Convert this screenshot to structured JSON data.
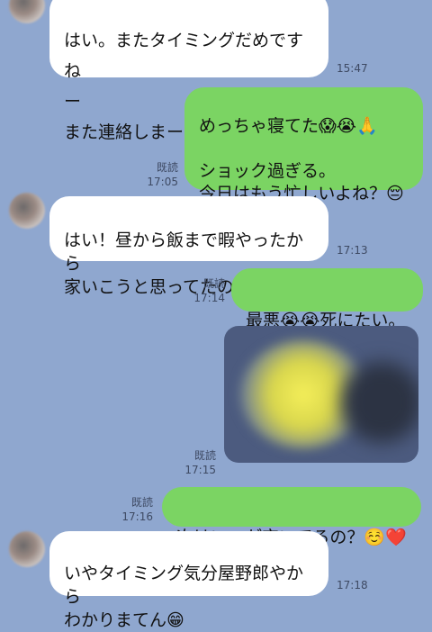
{
  "messages": [
    {
      "side": "in",
      "text": "はい。またタイミングだめですね\nー\nまた連絡しまーす！",
      "time": "15:47"
    },
    {
      "side": "out",
      "text": "めっちゃ寝てた😱😭🙏\n\nショック過ぎる。\n今日はもう忙しいよね？😔",
      "read": "既読",
      "time": "17:05"
    },
    {
      "side": "in",
      "text": "はい！昼から飯まで暇やったから\n家いこうと思ってたのにー",
      "time": "17:13"
    },
    {
      "side": "out",
      "text": "最悪😭😭死にたい。",
      "read": "既読",
      "time": "17:14"
    },
    {
      "side": "out",
      "type": "image",
      "read": "既読",
      "time": "17:15"
    },
    {
      "side": "out",
      "text": "次はいつが空いてるの？☺️❤️",
      "read": "既読",
      "time": "17:16"
    },
    {
      "side": "in",
      "text": "いやタイミング気分屋野郎やから\nわかりまてん😁",
      "time": "17:18"
    }
  ]
}
